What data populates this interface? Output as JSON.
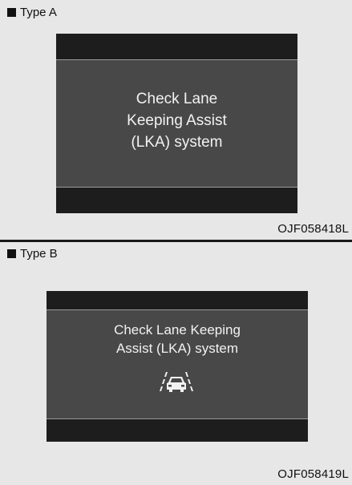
{
  "panel_a": {
    "type_label": "Type A",
    "message_lines": [
      "Check Lane",
      "Keeping Assist",
      "(LKA) system"
    ],
    "code": "OJF058418L"
  },
  "panel_b": {
    "type_label": "Type B",
    "message_lines": [
      "Check Lane Keeping",
      "Assist (LKA) system"
    ],
    "icon": "lane-keeping-assist-icon",
    "code": "OJF058419L"
  },
  "colors": {
    "page_background": "#e7e7e7",
    "screen_background": "#484848",
    "screen_band": "#1d1d1d",
    "screen_text": "#f2f2f2"
  }
}
